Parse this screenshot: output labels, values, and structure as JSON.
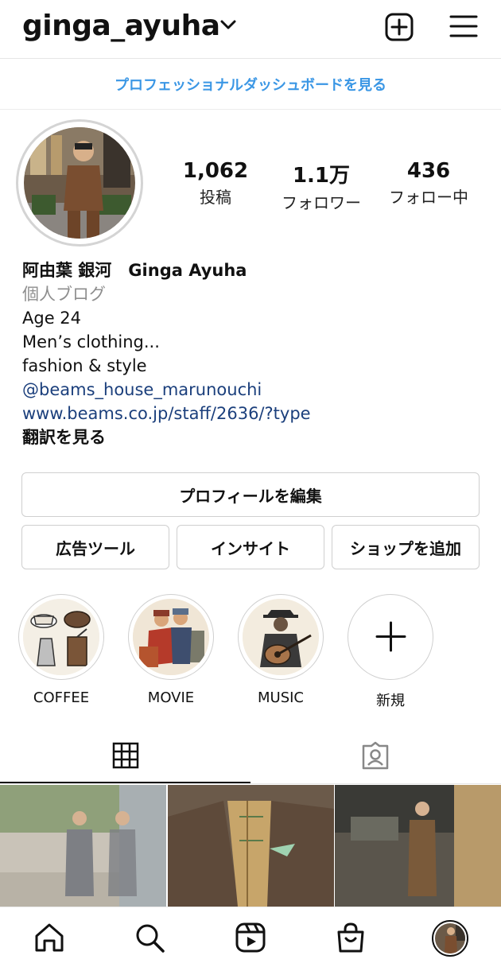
{
  "header": {
    "username": "ginga_ayuha",
    "dashboard_link": "プロフェッショナルダッシュボードを見る"
  },
  "profile": {
    "stats": [
      {
        "value": "1,062",
        "label": "投稿"
      },
      {
        "value": "1.1万",
        "label": "フォロワー"
      },
      {
        "value": "436",
        "label": "フォロー中"
      }
    ],
    "name": "阿由葉 銀河　Ginga Ayuha",
    "category": "個人ブログ",
    "bio_lines": [
      "Age 24",
      "Men’s clothing...",
      "fashion & style"
    ],
    "mention": "@beams_house_marunouchi",
    "website": "www.beams.co.jp/staff/2636/?type",
    "translate": "翻訳を見る"
  },
  "buttons": {
    "edit_profile": "プロフィールを編集",
    "ad_tools": "広告ツール",
    "insights": "インサイト",
    "add_shop": "ショップを追加"
  },
  "highlights": [
    {
      "label": "COFFEE"
    },
    {
      "label": "MOVIE"
    },
    {
      "label": "MUSIC"
    },
    {
      "label": "新規"
    }
  ],
  "icons": [
    "chevron-down-icon",
    "new-post-icon",
    "menu-icon",
    "grid-icon",
    "tagged-icon",
    "home-icon",
    "search-icon",
    "reels-icon",
    "shop-icon",
    "profile-avatar-icon",
    "plus-icon"
  ],
  "colors": {
    "link_blue": "#3b97e5",
    "bio_link": "#1b3f7c"
  }
}
